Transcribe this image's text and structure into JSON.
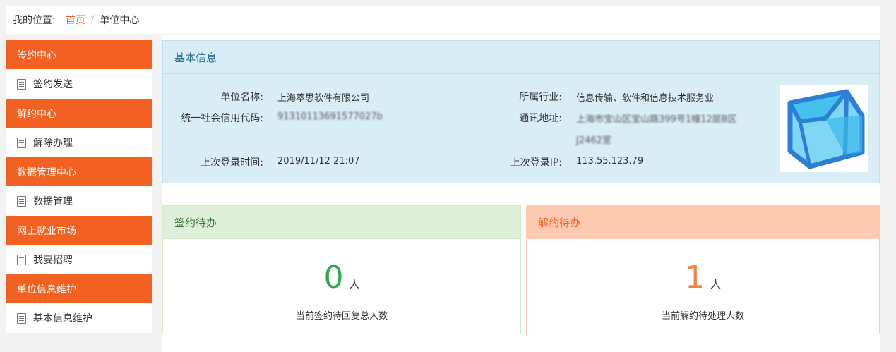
{
  "breadcrumb": {
    "prefix": "我的位置:",
    "home": "首页",
    "sep": "/",
    "current": "单位中心"
  },
  "sidebar": {
    "sections": [
      {
        "head": "签约中心",
        "item": "签约发送"
      },
      {
        "head": "解约中心",
        "item": "解除办理"
      },
      {
        "head": "数据管理中心",
        "item": "数据管理"
      },
      {
        "head": "网上就业市场",
        "item": "我要招聘"
      },
      {
        "head": "单位信息维护",
        "item": "基本信息维护"
      }
    ]
  },
  "basic": {
    "title": "基本信息",
    "fields": {
      "name_label": "单位名称:",
      "name_value": "上海萃思软件有限公司",
      "code_label": "统一社会信用代码:",
      "code_value": "91310113691577027b",
      "time_label": "上次登录时间:",
      "time_value": "2019/11/12 21:07",
      "industry_label": "所属行业:",
      "industry_value": "信息传输、软件和信息技术服务业",
      "address_label": "通讯地址:",
      "address_value": "上海市宝山区宝山路399号1幢12层B区",
      "address_value2": "J2462室",
      "ip_label": "上次登录IP:",
      "ip_value": "113.55.123.79"
    },
    "logo_icon": "cube-logo-icon"
  },
  "todo_sign": {
    "title": "签约待办",
    "count": "0",
    "unit": "人",
    "desc": "当前签约待回复总人数"
  },
  "todo_cancel": {
    "title": "解约待办",
    "count": "1",
    "unit": "人",
    "desc": "当前解约待处理人数"
  },
  "colors": {
    "accent": "#f26122",
    "info_bg": "#d9edf7",
    "success_bg": "#dff0d8",
    "success_num": "#2fa84f",
    "warn_bg": "#fdc9b0"
  }
}
